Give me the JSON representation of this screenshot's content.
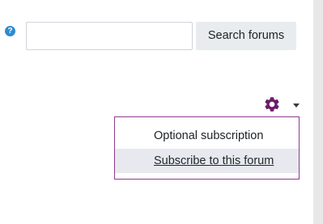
{
  "search": {
    "help_icon_glyph": "?",
    "input_value": "",
    "input_placeholder": "",
    "button_label": "Search forums"
  },
  "settings_menu": {
    "toggle_icon": "gear-icon",
    "caret_icon": "caret-down-icon",
    "accent_color": "#6a1b6a",
    "items": [
      {
        "label": "Optional subscription",
        "state": "default"
      },
      {
        "label": "Subscribe to this forum",
        "state": "hovered"
      }
    ]
  }
}
